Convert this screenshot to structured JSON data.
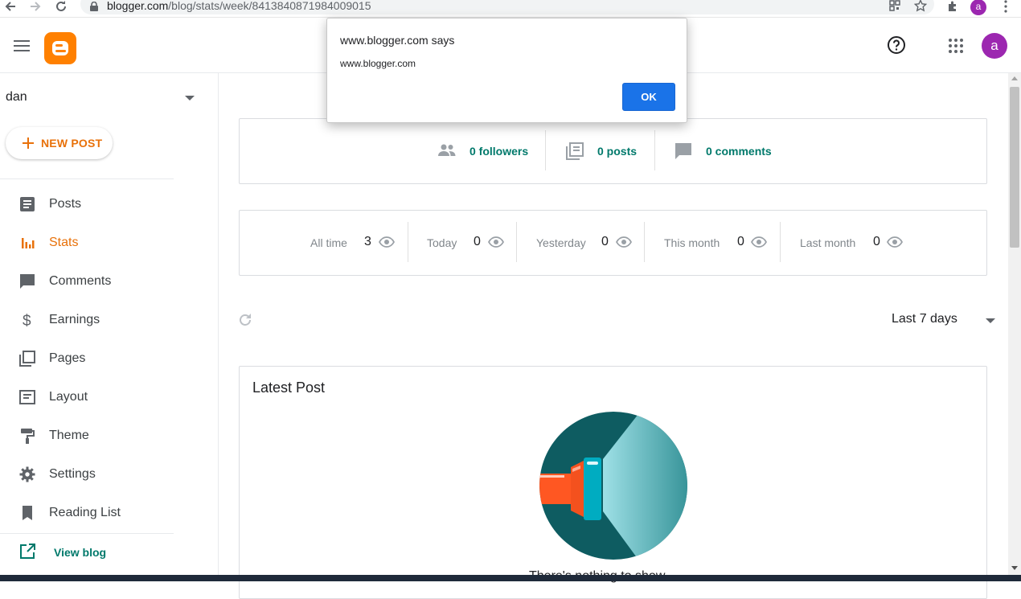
{
  "browser": {
    "url_host": "blogger.com",
    "url_path": "/blog/stats/week/8413840871984009015",
    "profile_letter": "a"
  },
  "header": {
    "avatar_letter": "a",
    "accent": "#e8710a",
    "logo_color": "#ff8000"
  },
  "sidebar": {
    "blog_name": "dan",
    "new_post_label": "NEW POST",
    "items": [
      {
        "label": "Posts",
        "icon": "posts-icon"
      },
      {
        "label": "Stats",
        "icon": "stats-icon",
        "active": true
      },
      {
        "label": "Comments",
        "icon": "comments-icon"
      },
      {
        "label": "Earnings",
        "icon": "dollar-icon"
      },
      {
        "label": "Pages",
        "icon": "pages-icon"
      },
      {
        "label": "Layout",
        "icon": "layout-icon"
      },
      {
        "label": "Theme",
        "icon": "paint-roller-icon"
      },
      {
        "label": "Settings",
        "icon": "gear-icon"
      },
      {
        "label": "Reading List",
        "icon": "bookmark-icon"
      }
    ],
    "view_blog_label": "View blog"
  },
  "counts": {
    "followers": "0 followers",
    "posts": "0 posts",
    "comments": "0 comments"
  },
  "views": [
    {
      "label": "All time",
      "value": "3"
    },
    {
      "label": "Today",
      "value": "0"
    },
    {
      "label": "Yesterday",
      "value": "0"
    },
    {
      "label": "This month",
      "value": "0"
    },
    {
      "label": "Last month",
      "value": "0"
    }
  ],
  "range": {
    "selected": "Last 7 days"
  },
  "latest": {
    "title": "Latest Post",
    "caption": "There's nothing to show"
  },
  "dialog": {
    "title": "www.blogger.com says",
    "message": "www.blogger.com",
    "ok_label": "OK"
  }
}
